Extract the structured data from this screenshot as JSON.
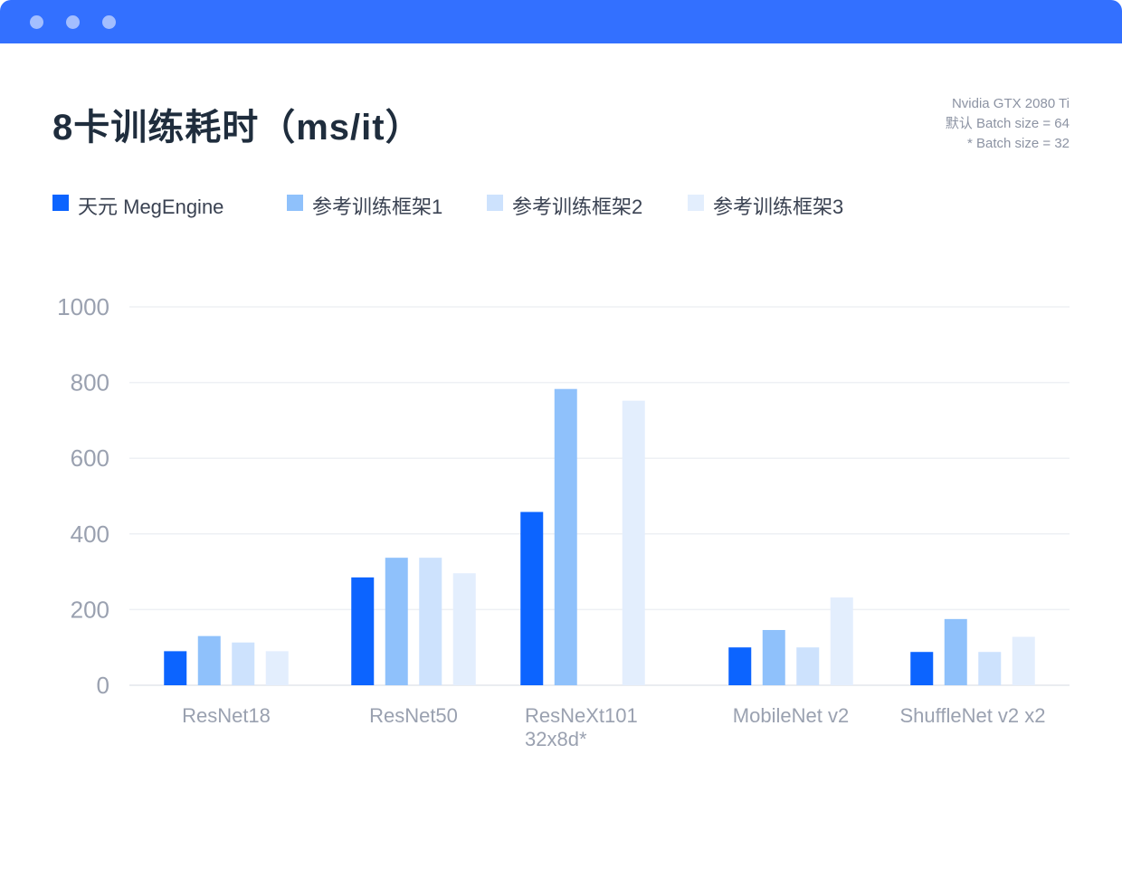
{
  "title": "8卡训练耗时（ms/it）",
  "note_lines": [
    "Nvidia GTX 2080 Ti",
    "默认 Batch size = 64",
    "* Batch size = 32"
  ],
  "window": {
    "accent": "#3370ff"
  },
  "chart_data": {
    "type": "bar",
    "title": "8卡训练耗时（ms/it）",
    "categories": [
      [
        "ResNet18"
      ],
      [
        "ResNet50"
      ],
      [
        "ResNeXt101",
        "32x8d*"
      ],
      [
        "MobileNet v2"
      ],
      [
        "ShuffleNet v2 x2"
      ]
    ],
    "series": [
      {
        "name": "天元 MegEngine",
        "color": "#0c64ff",
        "values": [
          90,
          285,
          458,
          100,
          88
        ]
      },
      {
        "name": "参考训练框架1",
        "color": "#8fc1fb",
        "values": [
          130,
          337,
          783,
          146,
          175
        ]
      },
      {
        "name": "参考训练框架2",
        "color": "#cde2fd",
        "values": [
          113,
          337,
          null,
          100,
          88
        ]
      },
      {
        "name": "参考训练框架3",
        "color": "#e3eefd",
        "values": [
          90,
          296,
          752,
          232,
          128
        ]
      }
    ],
    "ylim": [
      0,
      1000
    ],
    "yticks": [
      0,
      200,
      400,
      600,
      800,
      1000
    ],
    "grid": true,
    "legend_position": "top-left"
  }
}
